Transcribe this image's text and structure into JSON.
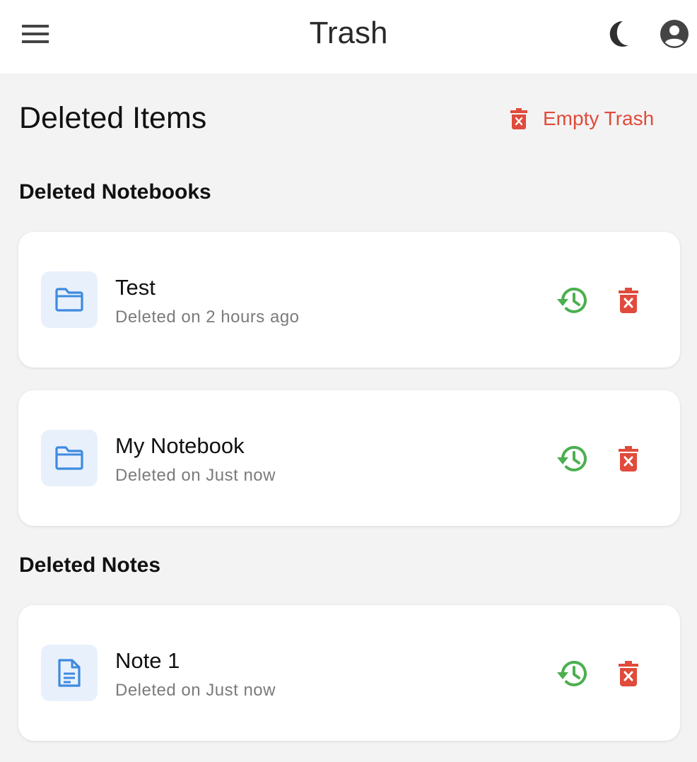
{
  "appbar": {
    "title": "Trash",
    "icons": {
      "menu": "menu-icon",
      "theme": "moon-icon",
      "account": "account-circle-icon"
    }
  },
  "page": {
    "title": "Deleted Items",
    "empty_trash_label": "Empty Trash"
  },
  "colors": {
    "danger": "#e04b3b",
    "restore": "#4caf50",
    "item_icon": "#3f8ae0",
    "thumb_bg": "#e8f1fb"
  },
  "sections": {
    "notebooks": {
      "title": "Deleted Notebooks",
      "items": [
        {
          "name": "Test",
          "meta": "Deleted on 2 hours ago",
          "icon": "folder-icon"
        },
        {
          "name": "My Notebook",
          "meta": "Deleted on Just now",
          "icon": "folder-icon"
        }
      ]
    },
    "notes": {
      "title": "Deleted Notes",
      "items": [
        {
          "name": "Note 1",
          "meta": "Deleted on Just now",
          "icon": "document-icon"
        }
      ]
    }
  }
}
